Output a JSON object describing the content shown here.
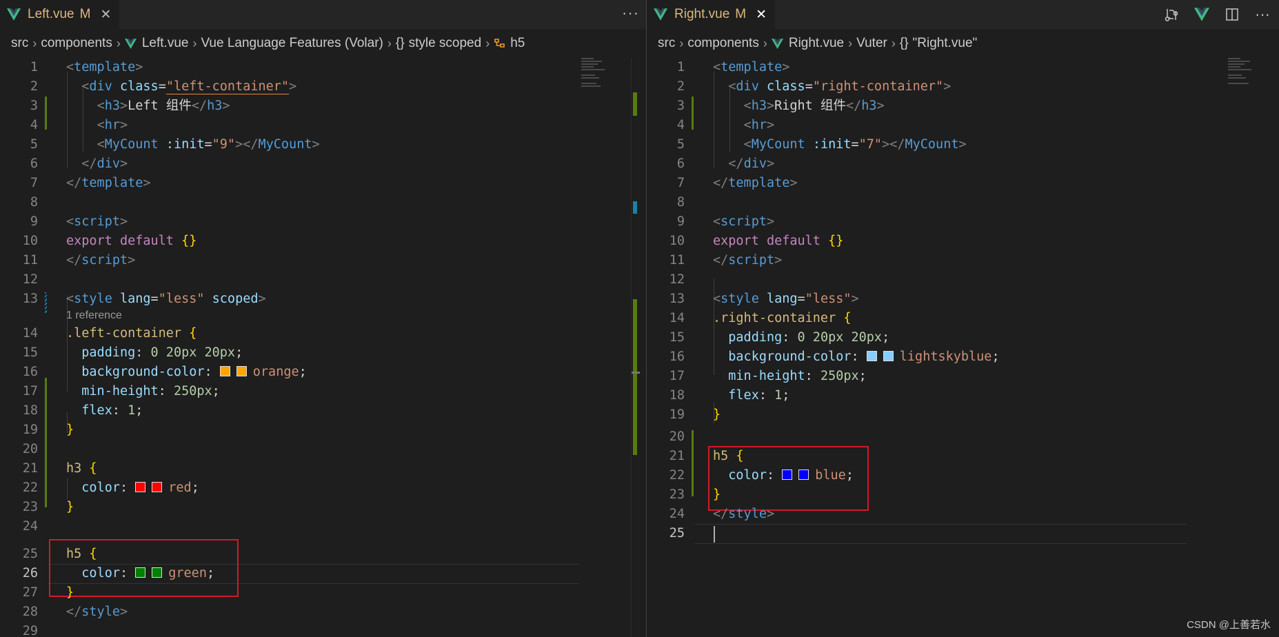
{
  "left": {
    "tab": {
      "name": "Left.vue",
      "modified": "M",
      "close": "✕",
      "more": "···"
    },
    "breadcrumb": {
      "parts": [
        "src",
        "components",
        "Left.vue",
        "Vue Language Features (Volar)",
        "{}",
        "style scoped",
        "h5"
      ],
      "separator": "›"
    },
    "lines": [
      {
        "n": "1"
      },
      {
        "n": "2"
      },
      {
        "n": "3"
      },
      {
        "n": "4"
      },
      {
        "n": "5"
      },
      {
        "n": "6"
      },
      {
        "n": "7"
      },
      {
        "n": "8"
      },
      {
        "n": "9"
      },
      {
        "n": "10"
      },
      {
        "n": "11"
      },
      {
        "n": "12"
      },
      {
        "n": "13"
      },
      {
        "n": "14"
      },
      {
        "n": "15"
      },
      {
        "n": "16"
      },
      {
        "n": "17"
      },
      {
        "n": "18"
      },
      {
        "n": "19"
      },
      {
        "n": "20"
      },
      {
        "n": "21"
      },
      {
        "n": "22"
      },
      {
        "n": "23"
      },
      {
        "n": "24"
      },
      {
        "n": "25"
      },
      {
        "n": "26"
      },
      {
        "n": "27"
      },
      {
        "n": "28"
      },
      {
        "n": "29"
      }
    ],
    "code": {
      "template_open": "template",
      "div_attr": "class",
      "div_class": "\"left-container\"",
      "h3_text": "Left 组件",
      "hr": "hr",
      "mycount_tag": "MyCount",
      "mycount_attr": ":init",
      "mycount_val": "\"9\"",
      "div_close": "div",
      "template_close": "template",
      "script_open": "script",
      "export_kw": "export",
      "default_kw": "default",
      "braces": "{}",
      "script_close": "script",
      "style_tag": "style",
      "style_lang_attr": "lang",
      "style_lang_val": "\"less\"",
      "style_scoped": "scoped",
      "reference": "1 reference",
      "sel_container": ".left-container",
      "padding_prop": "padding",
      "padding_val": "0 20px 20px",
      "bg_prop": "background-color",
      "bg_val": "orange",
      "bg_color": "#ffa500",
      "minh_prop": "min-height",
      "minh_val": "250px",
      "flex_prop": "flex",
      "flex_val": "1",
      "sel_h3": "h3",
      "color_prop": "color",
      "h3_color_val": "red",
      "h3_color": "#ff0000",
      "sel_h5": "h5",
      "h5_color_val": "green",
      "h5_color": "#008000",
      "style_close": "style"
    }
  },
  "right": {
    "tab": {
      "name": "Right.vue",
      "modified": "M",
      "close": "✕"
    },
    "breadcrumb": {
      "parts": [
        "src",
        "components",
        "Right.vue",
        "Vuter",
        "{}",
        "\"Right.vue\""
      ],
      "separator": "›"
    },
    "lines": [
      {
        "n": "1"
      },
      {
        "n": "2"
      },
      {
        "n": "3"
      },
      {
        "n": "4"
      },
      {
        "n": "5"
      },
      {
        "n": "6"
      },
      {
        "n": "7"
      },
      {
        "n": "8"
      },
      {
        "n": "9"
      },
      {
        "n": "10"
      },
      {
        "n": "11"
      },
      {
        "n": "12"
      },
      {
        "n": "13"
      },
      {
        "n": "14"
      },
      {
        "n": "15"
      },
      {
        "n": "16"
      },
      {
        "n": "17"
      },
      {
        "n": "18"
      },
      {
        "n": "19"
      },
      {
        "n": "20"
      },
      {
        "n": "21"
      },
      {
        "n": "22"
      },
      {
        "n": "23"
      },
      {
        "n": "24"
      },
      {
        "n": "25"
      }
    ],
    "code": {
      "div_class": "\"right-container\"",
      "h3_text": "Right 组件",
      "mycount_val": "\"7\"",
      "style_lang_val": "\"less\"",
      "sel_container": ".right-container",
      "bg_val": "lightskyblue",
      "bg_color": "#87cefa",
      "sel_h5": "h5",
      "h5_color_val": "blue",
      "h5_color": "#0000ff"
    }
  },
  "watermark": "CSDN @上善若水",
  "colors": {
    "vue_green": "#41b883",
    "gutter_added": "#587c0c",
    "highlight": "#d11a2a"
  }
}
